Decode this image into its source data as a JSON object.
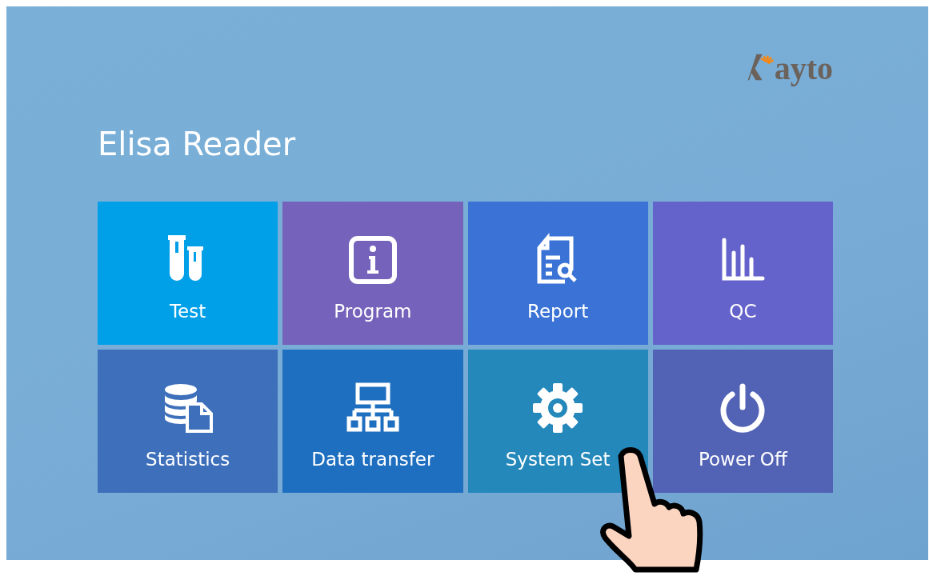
{
  "logo": {
    "text": "ayto"
  },
  "title": "Elisa Reader",
  "tiles": [
    {
      "kind": "tubes",
      "label": "Test",
      "color": "#00a0e9"
    },
    {
      "kind": "info",
      "label": "Program",
      "color": "#7563bb"
    },
    {
      "kind": "report",
      "label": "Report",
      "color": "#3a73d5"
    },
    {
      "kind": "chart",
      "label": "QC",
      "color": "#6462cb"
    },
    {
      "kind": "database",
      "label": "Statistics",
      "color": "#3d6fbb"
    },
    {
      "kind": "network",
      "label": "Data transfer",
      "color": "#1f6fc0"
    },
    {
      "kind": "gear",
      "label": "System Set",
      "color": "#2488bb"
    },
    {
      "kind": "power",
      "label": "Power Off",
      "color": "#5262b5"
    }
  ]
}
